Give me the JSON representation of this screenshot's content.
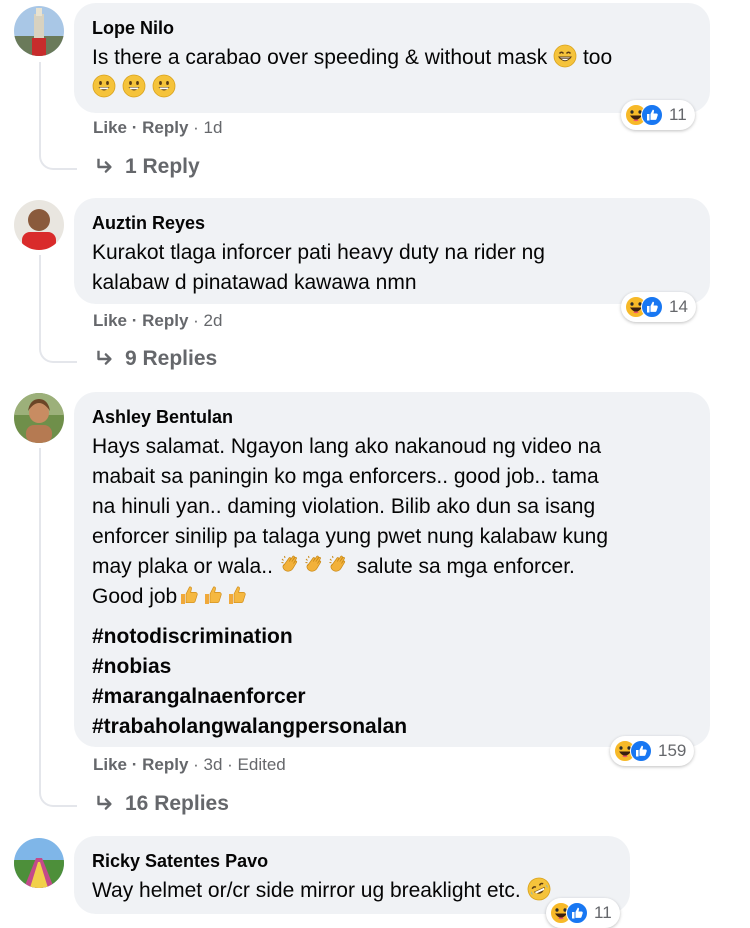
{
  "comments": [
    {
      "author": "Lope Nilo",
      "text": "Is there a carabao over speeding & without mask",
      "text_end": "too",
      "like": "Like",
      "reply": "Reply",
      "meta": " · 1d",
      "reaction_count": "11",
      "replies_label": "1 Reply"
    },
    {
      "author": "Auztin Reyes",
      "lines": [
        "Kurakot tlaga inforcer pati heavy duty na rider ng",
        "kalabaw d pinatawad kawawa nmn"
      ],
      "like": "Like",
      "reply": "Reply",
      "meta": " · 2d",
      "reaction_count": "14",
      "replies_label": "9 Replies"
    },
    {
      "author": "Ashley Bentulan",
      "lines": [
        "Hays salamat. Ngayon lang ako nakanoud ng video na",
        "mabait sa paningin ko mga enforcers.. good job.. tama",
        "na hinuli yan.. daming violation. Bilib ako dun sa isang",
        "enforcer sinilip pa talaga yung pwet nung kalabaw kung"
      ],
      "line5_start": "may plaka or wala..",
      "line5_end": "salute sa mga enforcer.",
      "line6": "Good job",
      "hashtags": [
        "#notodiscrimination",
        "#nobias",
        "#marangalnaenforcer",
        "#trabaholangwalangpersonalan"
      ],
      "like": "Like",
      "reply": "Reply",
      "meta": " · 3d · Edited",
      "reaction_count": "159",
      "replies_label": "16 Replies"
    },
    {
      "author": "Ricky Satentes Pavo",
      "text": "Way helmet or/cr side mirror ug breaklight etc.",
      "reaction_count": "11"
    }
  ],
  "colors": {
    "bubble": "#f0f2f5",
    "meta_text": "#65676b",
    "like_blue": "#1877f2",
    "haha_yellow": "#f7b928"
  },
  "icons": [
    "haha-icon",
    "like-icon",
    "reply-arrow-icon",
    "smile-emoji",
    "grin-emoji",
    "clap-emoji",
    "thumbs-up-emoji",
    "rofl-emoji"
  ]
}
